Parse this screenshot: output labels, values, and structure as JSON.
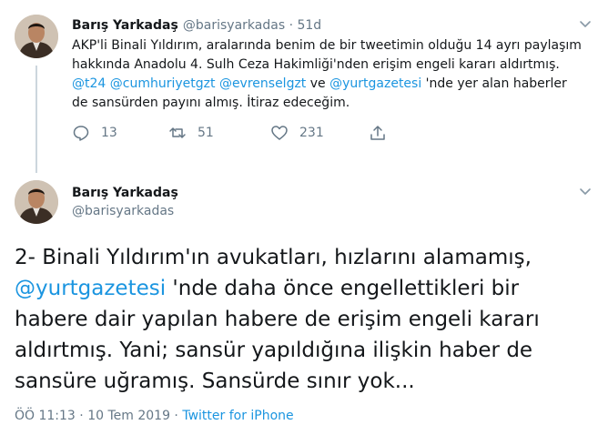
{
  "tweet1": {
    "author_name": "Barış Yarkadaş",
    "author_handle": "@barisyarkadas",
    "separator": " · ",
    "age": "51d",
    "text_parts": {
      "p1": "AKP'li Binali Yıldırım, aralarında benim de bir tweetimin olduğu 14 ayrı paylaşım hakkında Anadolu 4. Sulh Ceza Hakimliği'nden erişim engeli kararı aldırtmış. ",
      "m1": "@t24",
      "s1": " ",
      "m2": "@cumhuriyetgzt",
      "s2": " ",
      "m3": "@evrenselgzt",
      "s3": " ve ",
      "m4": "@yurtgazetesi",
      "p2": " 'nde yer alan haberler de sansürden payını almış. İtiraz edeceğim."
    },
    "actions": {
      "reply_count": "13",
      "retweet_count": "51",
      "like_count": "231"
    }
  },
  "tweet2": {
    "author_name": "Barış Yarkadaş",
    "author_handle": "@barisyarkadas",
    "text_parts": {
      "p1": "2- Binali Yıldırım'ın avukatları, hızlarını alamamış, ",
      "m1": "@yurtgazetesi",
      "p2": " 'nde daha önce engellettikleri bir habere dair yapılan habere de erişim engeli kararı aldırtmış. Yani; sansür yapıldığına ilişkin haber de sansüre uğramış. Sansürde sınır yok..."
    },
    "meta": {
      "time": "ÖÖ 11:13",
      "sep1": " · ",
      "date": "10 Tem 2019",
      "sep2": " · ",
      "client": "Twitter for iPhone"
    }
  },
  "colors": {
    "link": "#1b95e0",
    "secondary_text": "#657786",
    "primary_text": "#14171a",
    "thread_line": "#ccd6dd"
  },
  "icons": [
    "avatar",
    "chevron-down-icon",
    "reply-icon",
    "retweet-icon",
    "like-icon",
    "share-icon"
  ]
}
